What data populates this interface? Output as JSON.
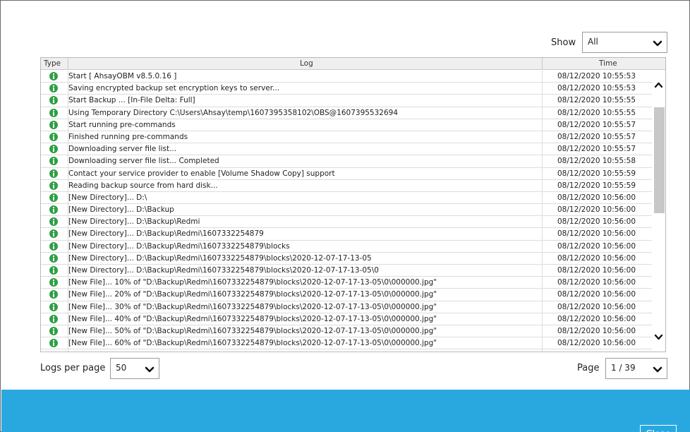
{
  "filter": {
    "show_label": "Show",
    "show_value": "All"
  },
  "table": {
    "headers": {
      "type": "Type",
      "log": "Log",
      "time": "Time"
    },
    "rows": [
      {
        "type_icon": "info-icon",
        "log": "Start [ AhsayOBM v8.5.0.16 ]",
        "time": "08/12/2020 10:55:53"
      },
      {
        "type_icon": "info-icon",
        "log": "Saving encrypted backup set encryption keys to server...",
        "time": "08/12/2020 10:55:53"
      },
      {
        "type_icon": "info-icon",
        "log": "Start Backup ... [In-File Delta: Full]",
        "time": "08/12/2020 10:55:55"
      },
      {
        "type_icon": "info-icon",
        "log": "Using Temporary Directory C:\\Users\\Ahsay\\temp\\1607395358102\\OBS@1607395532694",
        "time": "08/12/2020 10:55:55"
      },
      {
        "type_icon": "info-icon",
        "log": "Start running pre-commands",
        "time": "08/12/2020 10:55:57"
      },
      {
        "type_icon": "info-icon",
        "log": "Finished running pre-commands",
        "time": "08/12/2020 10:55:57"
      },
      {
        "type_icon": "info-icon",
        "log": "Downloading server file list...",
        "time": "08/12/2020 10:55:57"
      },
      {
        "type_icon": "info-icon",
        "log": "Downloading server file list... Completed",
        "time": "08/12/2020 10:55:58"
      },
      {
        "type_icon": "info-icon",
        "log": "Contact your service provider to enable [Volume Shadow Copy] support",
        "time": "08/12/2020 10:55:59"
      },
      {
        "type_icon": "info-icon",
        "log": "Reading backup source from hard disk...",
        "time": "08/12/2020 10:55:59"
      },
      {
        "type_icon": "info-icon",
        "log": "[New Directory]... D:\\",
        "time": "08/12/2020 10:56:00"
      },
      {
        "type_icon": "info-icon",
        "log": "[New Directory]... D:\\Backup",
        "time": "08/12/2020 10:56:00"
      },
      {
        "type_icon": "info-icon",
        "log": "[New Directory]... D:\\Backup\\Redmi",
        "time": "08/12/2020 10:56:00"
      },
      {
        "type_icon": "info-icon",
        "log": "[New Directory]... D:\\Backup\\Redmi\\1607332254879",
        "time": "08/12/2020 10:56:00"
      },
      {
        "type_icon": "info-icon",
        "log": "[New Directory]... D:\\Backup\\Redmi\\1607332254879\\blocks",
        "time": "08/12/2020 10:56:00"
      },
      {
        "type_icon": "info-icon",
        "log": "[New Directory]... D:\\Backup\\Redmi\\1607332254879\\blocks\\2020-12-07-17-13-05",
        "time": "08/12/2020 10:56:00"
      },
      {
        "type_icon": "info-icon",
        "log": "[New Directory]... D:\\Backup\\Redmi\\1607332254879\\blocks\\2020-12-07-17-13-05\\0",
        "time": "08/12/2020 10:56:00"
      },
      {
        "type_icon": "info-icon",
        "log": "[New File]... 10% of \"D:\\Backup\\Redmi\\1607332254879\\blocks\\2020-12-07-17-13-05\\0\\000000.jpg\"",
        "time": "08/12/2020 10:56:00"
      },
      {
        "type_icon": "info-icon",
        "log": "[New File]... 20% of \"D:\\Backup\\Redmi\\1607332254879\\blocks\\2020-12-07-17-13-05\\0\\000000.jpg\"",
        "time": "08/12/2020 10:56:00"
      },
      {
        "type_icon": "info-icon",
        "log": "[New File]... 30% of \"D:\\Backup\\Redmi\\1607332254879\\blocks\\2020-12-07-17-13-05\\0\\000000.jpg\"",
        "time": "08/12/2020 10:56:00"
      },
      {
        "type_icon": "info-icon",
        "log": "[New File]... 40% of \"D:\\Backup\\Redmi\\1607332254879\\blocks\\2020-12-07-17-13-05\\0\\000000.jpg\"",
        "time": "08/12/2020 10:56:00"
      },
      {
        "type_icon": "info-icon",
        "log": "[New File]... 50% of \"D:\\Backup\\Redmi\\1607332254879\\blocks\\2020-12-07-17-13-05\\0\\000000.jpg\"",
        "time": "08/12/2020 10:56:00"
      },
      {
        "type_icon": "info-icon",
        "log": "[New File]... 60% of \"D:\\Backup\\Redmi\\1607332254879\\blocks\\2020-12-07-17-13-05\\0\\000000.jpg\"",
        "time": "08/12/2020 10:56:00"
      }
    ]
  },
  "pagination": {
    "logs_per_page_label": "Logs per page",
    "logs_per_page_value": "50",
    "page_label": "Page",
    "page_value": "1 / 39"
  },
  "actions": {
    "close_label": "Close"
  },
  "colors": {
    "accent_bar": "#29a8e0",
    "info_icon": "#2ea043"
  }
}
